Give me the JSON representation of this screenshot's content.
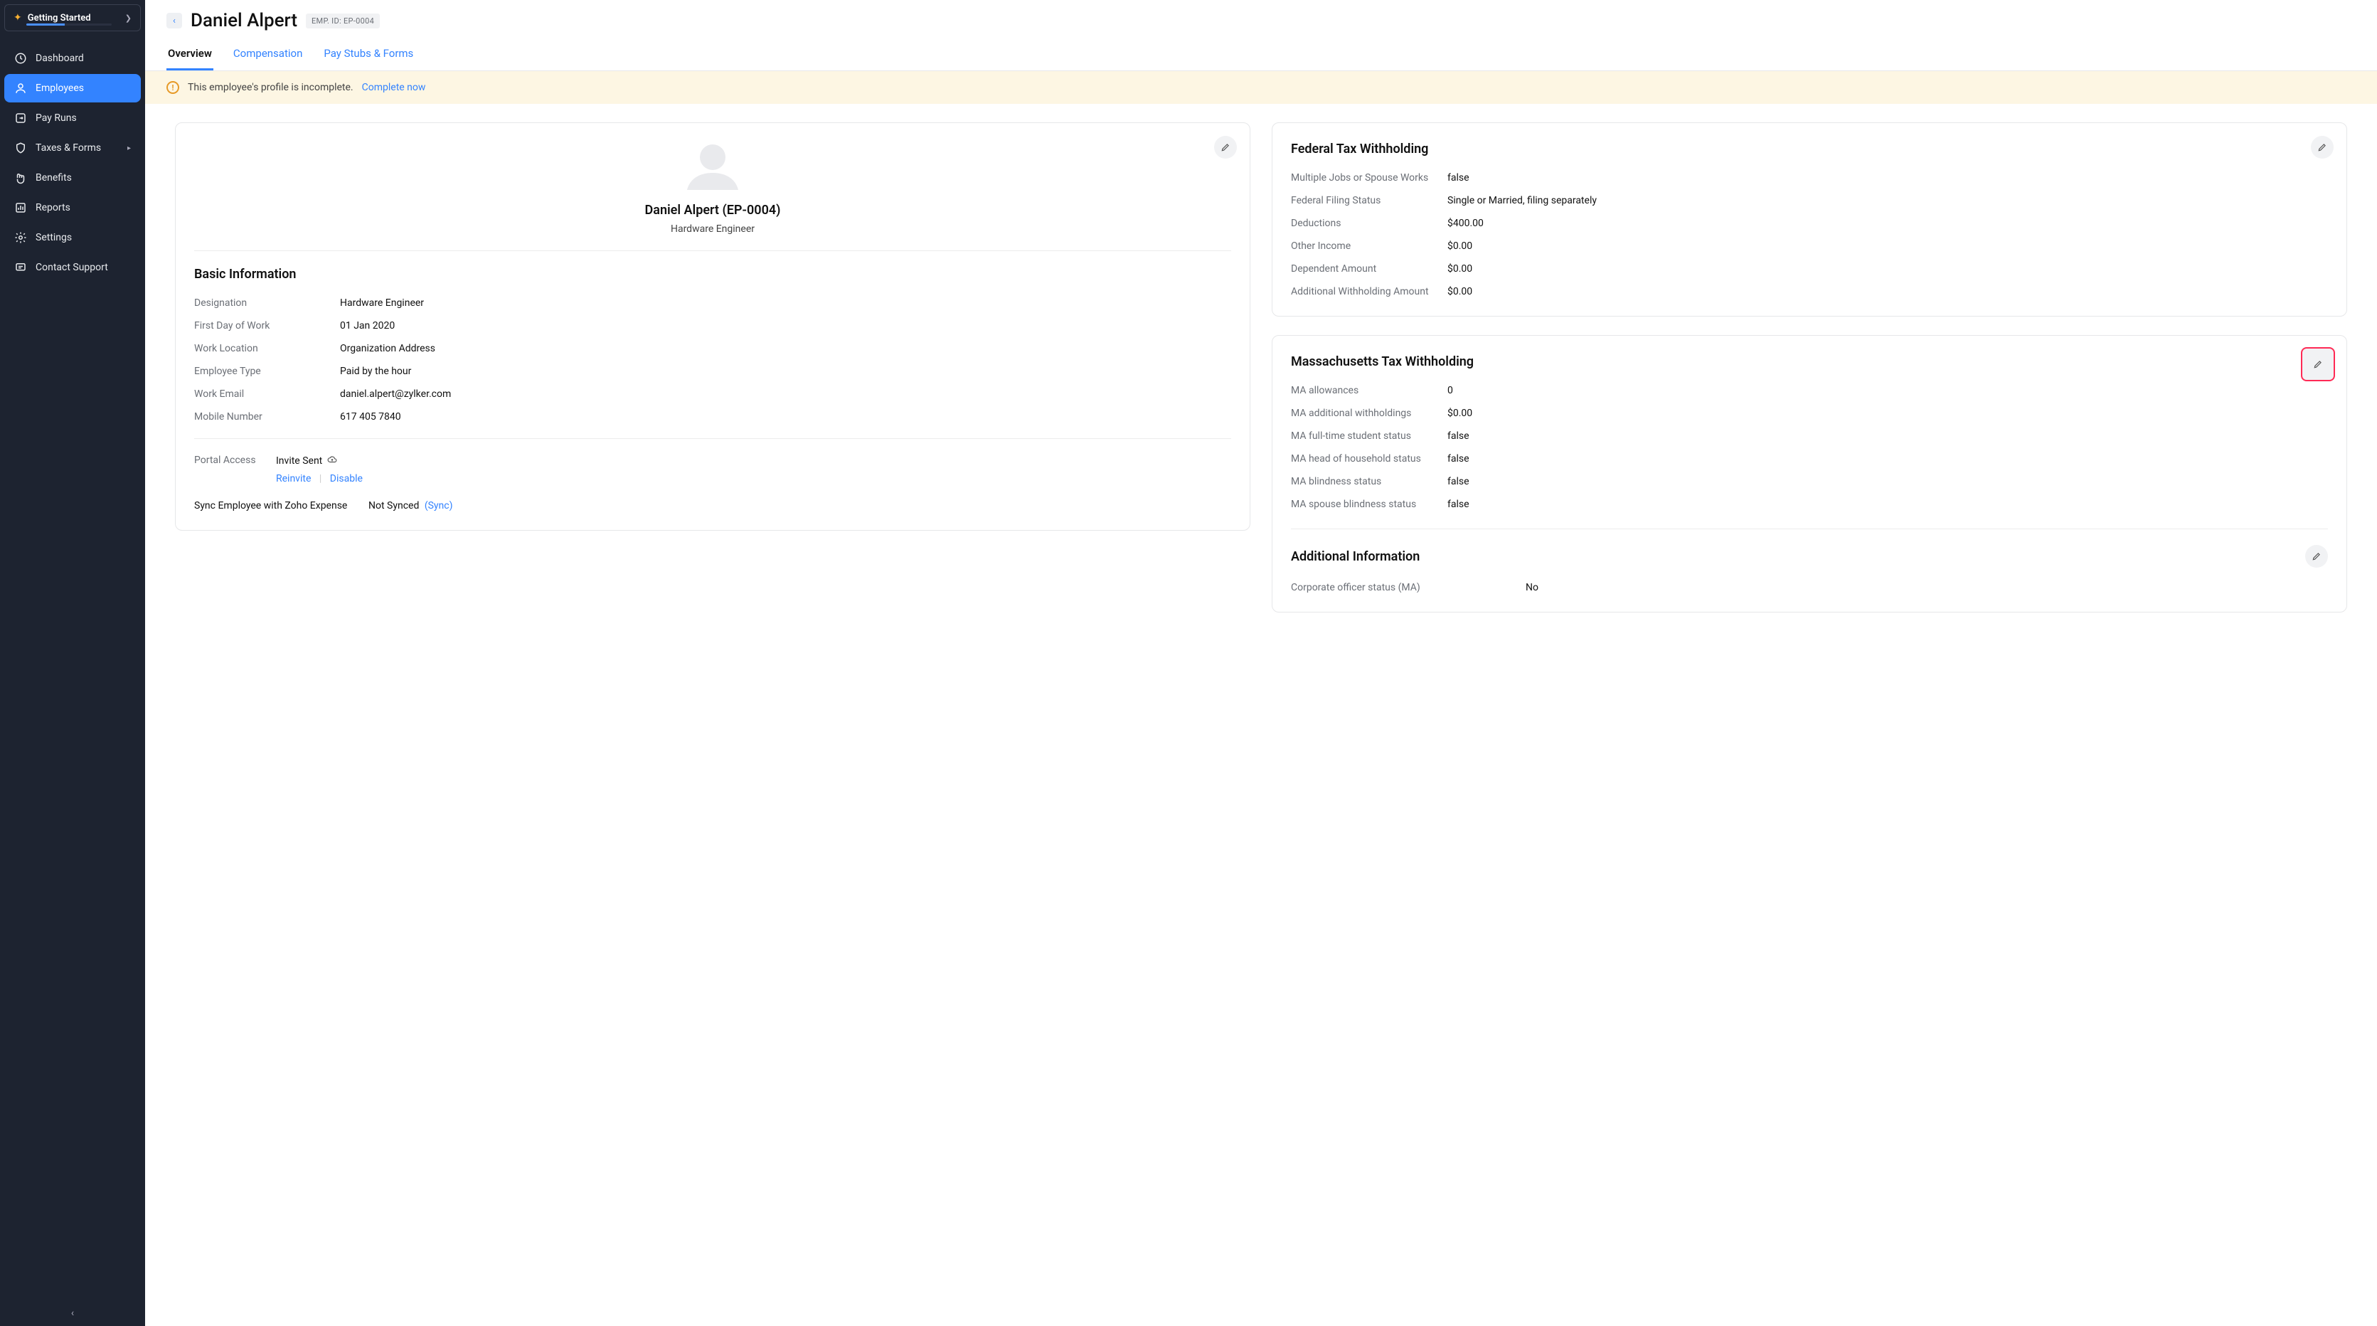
{
  "sidebar": {
    "getting_started": "Getting Started",
    "items": [
      {
        "label": "Dashboard"
      },
      {
        "label": "Employees"
      },
      {
        "label": "Pay Runs"
      },
      {
        "label": "Taxes & Forms"
      },
      {
        "label": "Benefits"
      },
      {
        "label": "Reports"
      },
      {
        "label": "Settings"
      },
      {
        "label": "Contact Support"
      }
    ]
  },
  "header": {
    "employee_name": "Daniel Alpert",
    "emp_id_label": "EMP. ID: EP-0004"
  },
  "tabs": {
    "overview": "Overview",
    "compensation": "Compensation",
    "paystubs": "Pay Stubs & Forms"
  },
  "alert": {
    "text": "This employee's profile is incomplete.",
    "link": "Complete now"
  },
  "profile": {
    "title": "Daniel Alpert (EP-0004)",
    "role": "Hardware Engineer",
    "basic_heading": "Basic Information",
    "fields": {
      "designation_k": "Designation",
      "designation_v": "Hardware Engineer",
      "first_day_k": "First Day of Work",
      "first_day_v": "01 Jan 2020",
      "location_k": "Work Location",
      "location_v": "Organization Address",
      "emp_type_k": "Employee Type",
      "emp_type_v": "Paid by the hour",
      "email_k": "Work Email",
      "email_v": "daniel.alpert@zylker.com",
      "mobile_k": "Mobile Number",
      "mobile_v": "617 405 7840"
    },
    "portal": {
      "label": "Portal Access",
      "status": "Invite Sent",
      "reinvite": "Reinvite",
      "disable": "Disable"
    },
    "sync": {
      "label": "Sync Employee with Zoho Expense",
      "status": "Not Synced",
      "link": "(Sync)"
    }
  },
  "federal": {
    "heading": "Federal Tax Withholding",
    "rows": [
      {
        "k": "Multiple Jobs or Spouse Works",
        "v": "false"
      },
      {
        "k": "Federal Filing Status",
        "v": "Single or Married, filing separately"
      },
      {
        "k": "Deductions",
        "v": "$400.00"
      },
      {
        "k": "Other Income",
        "v": "$0.00"
      },
      {
        "k": "Dependent Amount",
        "v": "$0.00"
      },
      {
        "k": "Additional Withholding Amount",
        "v": "$0.00"
      }
    ]
  },
  "mass": {
    "heading": "Massachusetts Tax Withholding",
    "rows": [
      {
        "k": "MA allowances",
        "v": "0"
      },
      {
        "k": "MA additional withholdings",
        "v": "$0.00"
      },
      {
        "k": "MA full-time student status",
        "v": "false"
      },
      {
        "k": "MA head of household status",
        "v": "false"
      },
      {
        "k": "MA blindness status",
        "v": "false"
      },
      {
        "k": "MA spouse blindness status",
        "v": "false"
      }
    ]
  },
  "additional": {
    "heading": "Additional Information",
    "rows": [
      {
        "k": "Corporate officer status (MA)",
        "v": "No"
      }
    ]
  }
}
